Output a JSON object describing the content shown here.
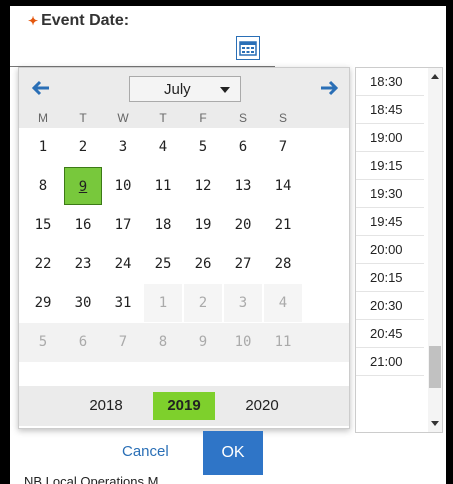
{
  "field": {
    "label": "Event Date:",
    "required_marker": "✦"
  },
  "calendar": {
    "month": "July",
    "weekdays": [
      "M",
      "T",
      "W",
      "T",
      "F",
      "S",
      "S"
    ],
    "weeks": [
      [
        "1",
        "2",
        "3",
        "4",
        "5",
        "6",
        "7"
      ],
      [
        "8",
        "9",
        "10",
        "11",
        "12",
        "13",
        "14"
      ],
      [
        "15",
        "16",
        "17",
        "18",
        "19",
        "20",
        "21"
      ],
      [
        "22",
        "23",
        "24",
        "25",
        "26",
        "27",
        "28"
      ],
      [
        "29",
        "30",
        "31",
        "1",
        "2",
        "3",
        "4"
      ],
      [
        "5",
        "6",
        "7",
        "8",
        "9",
        "10",
        "11"
      ]
    ],
    "selected_day": "9",
    "years": [
      "2018",
      "2019",
      "2020"
    ],
    "selected_year": "2019"
  },
  "times": [
    "18:30",
    "18:45",
    "19:00",
    "19:15",
    "19:30",
    "19:45",
    "20:00",
    "20:15",
    "20:30",
    "20:45",
    "21:00"
  ],
  "actions": {
    "cancel_label": "Cancel",
    "ok_label": "OK"
  },
  "footer": {
    "text": "NB Local Operations M..."
  },
  "colors": {
    "selected": "#78c83c",
    "primary": "#2f75c7",
    "required": "#e4570e"
  }
}
